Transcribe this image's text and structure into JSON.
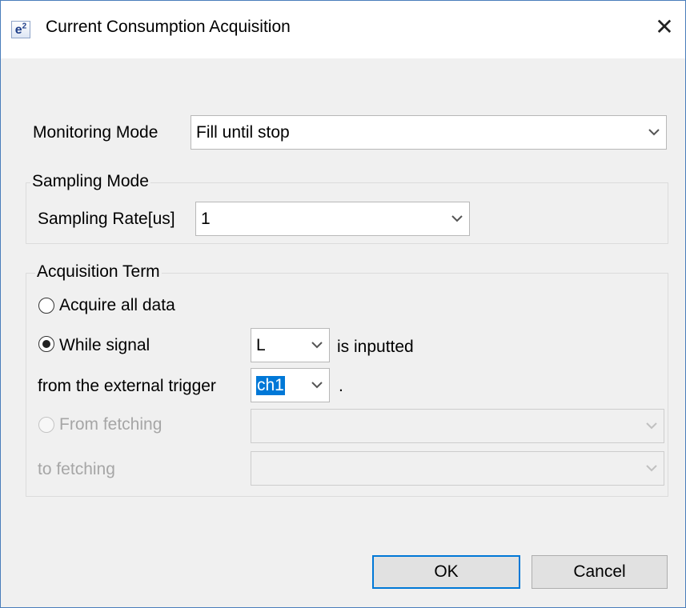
{
  "window": {
    "title": "Current Consumption Acquisition",
    "icon_text": "e",
    "icon_sup": "2",
    "close_glyph": "✕"
  },
  "monitoring": {
    "label": "Monitoring Mode",
    "value": "Fill until stop"
  },
  "sampling": {
    "group_title": "Sampling Mode",
    "rate_label": "Sampling Rate[us]",
    "rate_value": "1"
  },
  "acquisition": {
    "group_title": "Acquisition Term",
    "option_all": "Acquire all data",
    "option_signal": "While signal",
    "signal_value": "L",
    "signal_suffix": "is inputted",
    "trigger_label": "from the external trigger",
    "trigger_value": "ch1",
    "trigger_suffix": ".",
    "option_fetch_from": "From fetching",
    "fetch_from_value": "",
    "fetch_to_label": "to fetching",
    "fetch_to_value": "",
    "selected_option": "While signal"
  },
  "buttons": {
    "ok": "OK",
    "cancel": "Cancel"
  },
  "colors": {
    "accent": "#0078d7",
    "window_border": "#4a7ebb",
    "background": "#f0f0f0",
    "disabled_text": "#a6a6a6"
  },
  "icons": {
    "dropdown": "chevron-down-icon",
    "close": "close-icon",
    "app": "e2-studio-icon"
  }
}
